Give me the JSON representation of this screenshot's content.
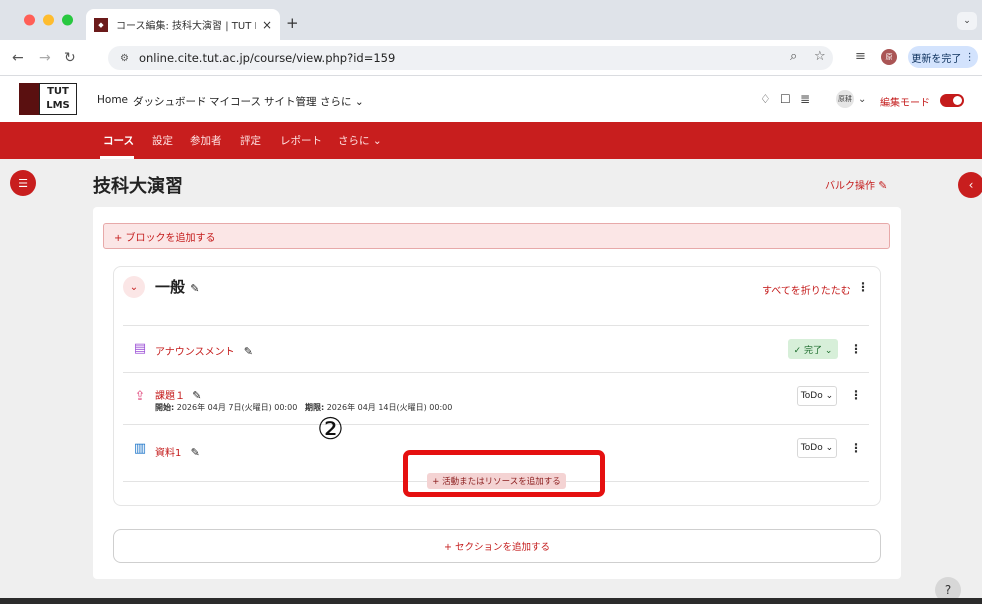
{
  "browser": {
    "tab_title": "コース編集: 技科大演習 | TUT LMS",
    "tab_close": "×",
    "new_tab": "+",
    "url": "online.cite.tut.ac.jp/course/view.php?id=159",
    "update_button": "更新を完了",
    "menu_glyph": "⋮",
    "profile_initials": "原"
  },
  "site": {
    "logo_text_1": "TUT",
    "logo_text_2": "LMS",
    "nav": [
      "Home",
      "ダッシュボード",
      "マイコース",
      "サイト管理",
      "さらに ⌄"
    ],
    "user_name": "原耕",
    "user_caret": "⌄",
    "edit_mode_label": "編集モード"
  },
  "course_nav": {
    "items": [
      "コース",
      "設定",
      "参加者",
      "評定",
      "レポート",
      "さらに ⌄"
    ]
  },
  "course": {
    "title": "技科大演習",
    "bulk_edit": "バルク操作",
    "add_block": "+ ブロックを追加する",
    "section": {
      "name": "一般",
      "collapse_all": "すべてを折りたたむ",
      "activities": [
        {
          "name": "アナウンスメント",
          "icon": "forum-icon",
          "status": "✓ 完了 ⌄"
        },
        {
          "name": "課題１",
          "icon": "assignment-icon",
          "open_label": "開始:",
          "open_date": "2026年 04月 7日(火曜日) 00:00",
          "due_label": "期限:",
          "due_date": "2026年 04月 14日(火曜日) 00:00",
          "status": "ToDo ⌄"
        },
        {
          "name": "資料1",
          "icon": "pdf-file-icon",
          "status": "ToDo ⌄"
        }
      ],
      "add_activity": "+ 活動またはリソースを追加する"
    },
    "add_section": "+ セクションを追加する"
  },
  "annotation": {
    "step_number": "②",
    "highlight_color": "#e51010"
  },
  "colors": {
    "brand_red": "#c81e1e",
    "done_green": "#d7efd9"
  },
  "help": "?"
}
